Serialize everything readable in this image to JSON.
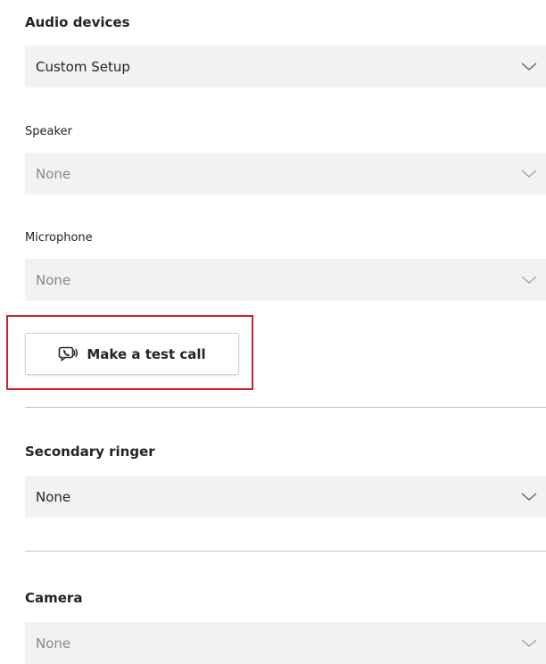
{
  "audio_devices": {
    "title": "Audio devices",
    "selected": "Custom Setup"
  },
  "speaker": {
    "label": "Speaker",
    "selected": "None"
  },
  "microphone": {
    "label": "Microphone",
    "selected": "None"
  },
  "test_call": {
    "label": "Make a test call",
    "icon": "test-call-icon",
    "highlight_color": "#c4262e"
  },
  "secondary_ringer": {
    "title": "Secondary ringer",
    "selected": "None"
  },
  "camera": {
    "title": "Camera",
    "selected": "None"
  },
  "colors": {
    "dropdown_bg": "#f3f2f1",
    "text": "#252423",
    "muted_text": "#8a8886",
    "divider": "#c8c6c4"
  }
}
